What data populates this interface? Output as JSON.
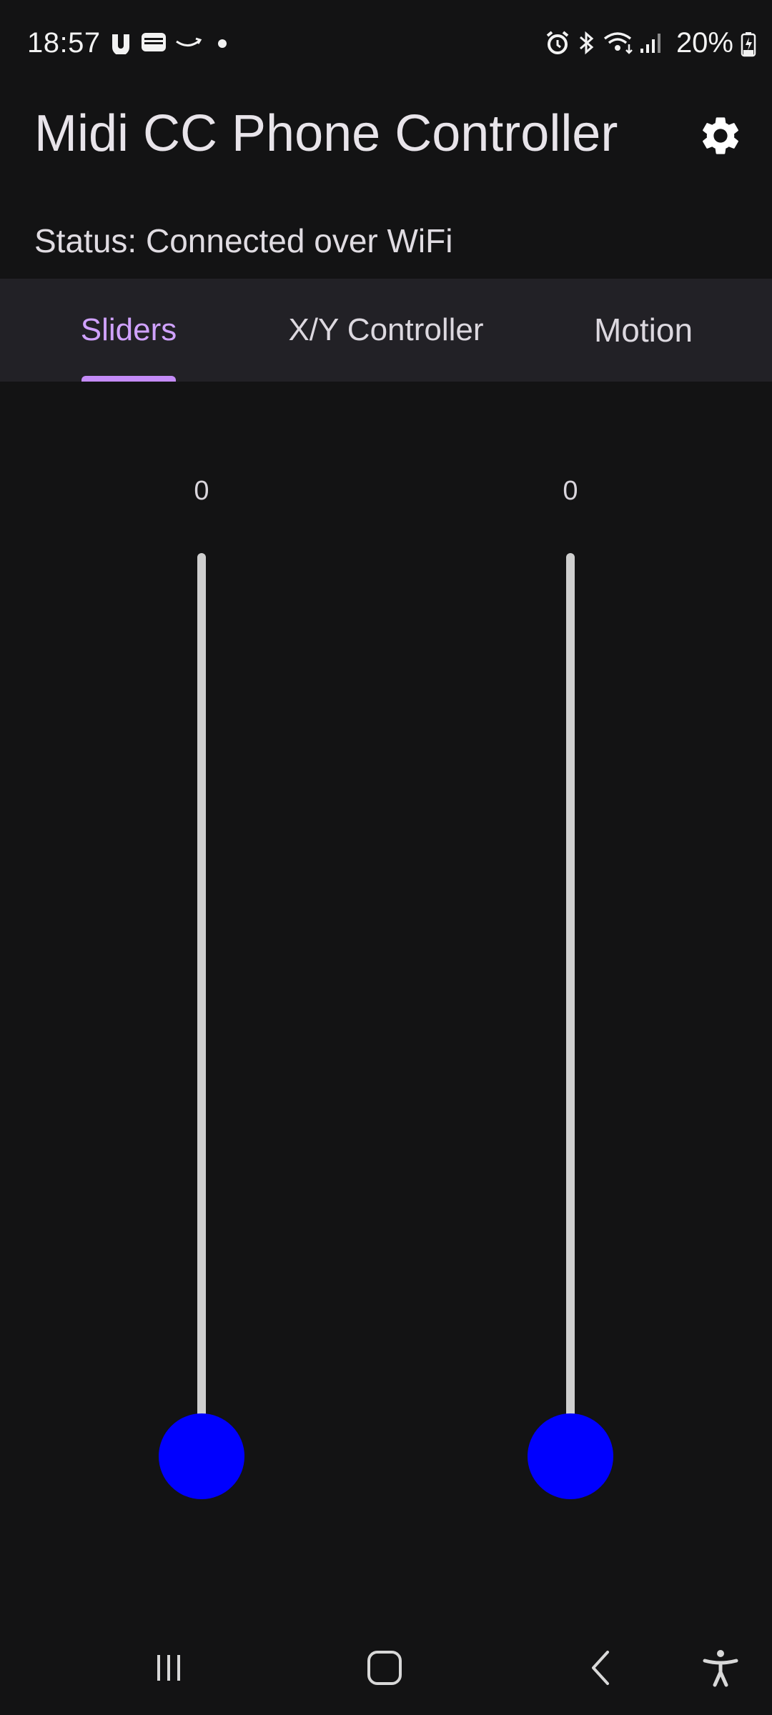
{
  "status_bar": {
    "time": "18:57",
    "battery_percent": "20%",
    "left_icons": [
      "notification-app-icon",
      "wallet-icon",
      "amazon-smile-icon",
      "dot-icon"
    ],
    "right_icons": [
      "alarm-icon",
      "bluetooth-icon",
      "wifi-icon",
      "signal-icon",
      "battery-charging-icon"
    ]
  },
  "header": {
    "title": "Midi CC Phone Controller",
    "settings_icon": "gear-icon",
    "status": "Status: Connected over WiFi"
  },
  "tabs": [
    {
      "label": "Sliders",
      "active": true
    },
    {
      "label": "X/Y Controller",
      "active": false
    },
    {
      "label": "Motion",
      "active": false
    }
  ],
  "colors": {
    "background": "#131314",
    "tab_bar": "#222126",
    "accent": "#c48bf7",
    "thumb": "#0000ff",
    "track": "#cfcfcf"
  },
  "sliders": [
    {
      "value": "0",
      "level": 0
    },
    {
      "value": "0",
      "level": 0
    }
  ],
  "nav_bar": {
    "buttons": [
      "recent-apps-icon",
      "home-icon",
      "back-icon",
      "accessibility-icon"
    ]
  }
}
